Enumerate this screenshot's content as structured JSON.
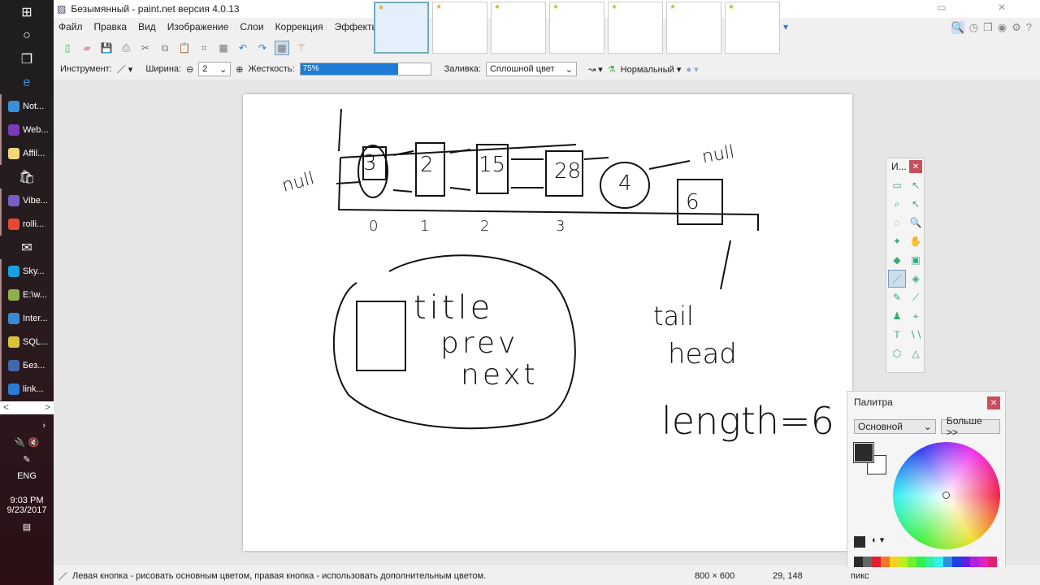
{
  "taskbar": {
    "items": [
      {
        "label": "Not...",
        "color": "#3a8fd6"
      },
      {
        "label": "Web...",
        "color": "#7b3ab8"
      },
      {
        "label": "Affil...",
        "color": "#f5d67a"
      },
      {
        "label": "Vibe...",
        "color": "#7460c4"
      },
      {
        "label": "rolli...",
        "color": "#e44b35"
      },
      {
        "label": "Sky...",
        "color": "#1aa0e0"
      },
      {
        "label": "E:\\w...",
        "color": "#8fb04a"
      },
      {
        "label": "Inter...",
        "color": "#3c8ad6"
      },
      {
        "label": "SQL...",
        "color": "#d8c23c"
      },
      {
        "label": "Без...",
        "color": "#4466aa"
      },
      {
        "label": "link...",
        "color": "#2d7bd3"
      }
    ],
    "lang": "ENG",
    "time": "9:03 PM",
    "date": "9/23/2017"
  },
  "app": {
    "title": "Безымянный - paint.net версия 4.0.13",
    "menu": [
      "Файл",
      "Правка",
      "Вид",
      "Изображение",
      "Слои",
      "Коррекция",
      "Эффекты"
    ],
    "options": {
      "tool_label": "Инструмент:",
      "width_label": "Ширина:",
      "width_value": "2",
      "hardness_label": "Жесткость:",
      "hardness_value": "75%",
      "hardness": 0.75,
      "fill_label": "Заливка:",
      "fill_value": "Сплошной цвет",
      "blend_value": "Нормальный"
    },
    "tools_title": "И...",
    "palette": {
      "title": "Палитра",
      "mode": "Основной",
      "more": "Больше >>",
      "primary": "#2b2b2b",
      "secondary": "#ffffff",
      "swatches": [
        "#2b2b2b",
        "#666666",
        "#e02030",
        "#f07828",
        "#f8d020",
        "#b8f020",
        "#70f030",
        "#30f050",
        "#30f0a0",
        "#30f0f0",
        "#3090e0",
        "#2040e0",
        "#6020e0",
        "#b020e0",
        "#e020c0",
        "#e02070"
      ]
    },
    "status": {
      "hint": "Левая кнопка - рисовать основным цветом, правая кнопка - использовать дополнительным цветом.",
      "size": "800 × 600",
      "coords": "29, 148",
      "unit": "пикс"
    }
  },
  "drawing": {
    "null_left": "null",
    "null_right": "null",
    "nodes": [
      "3",
      "2",
      "15",
      "28",
      "4",
      "6"
    ],
    "indices": [
      "0",
      "1",
      "2",
      "3"
    ],
    "title": "title",
    "prev": "prev",
    "next": "next",
    "tail": "tail",
    "head": "head",
    "length": "length=6"
  }
}
